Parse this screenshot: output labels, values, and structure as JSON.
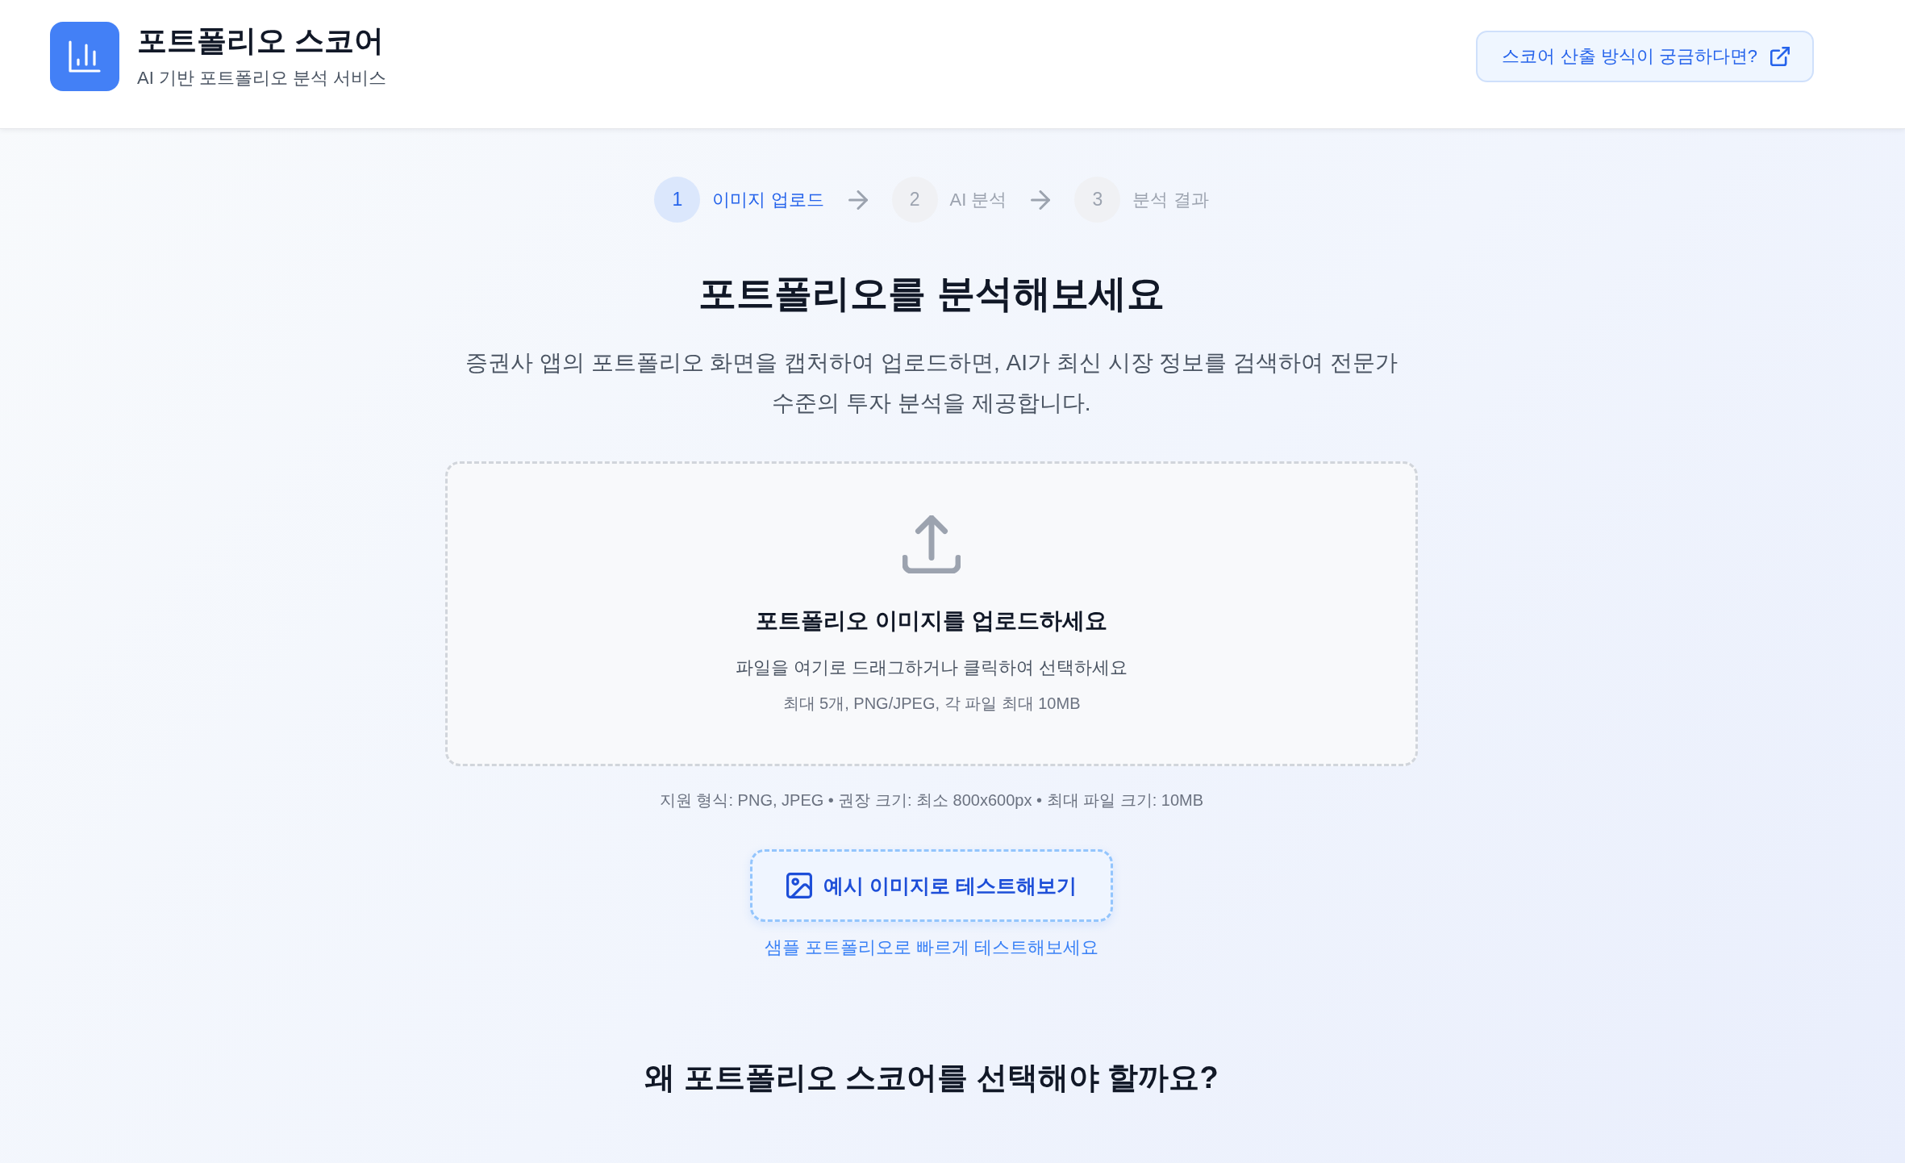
{
  "header": {
    "title": "포트폴리오 스코어",
    "subtitle": "AI 기반 포트폴리오 분석 서비스",
    "help_link": "스코어 산출 방식이 궁금하다면?"
  },
  "steps": [
    {
      "number": "1",
      "label": "이미지 업로드",
      "active": true
    },
    {
      "number": "2",
      "label": "AI 분석",
      "active": false
    },
    {
      "number": "3",
      "label": "분석 결과",
      "active": false
    }
  ],
  "hero": {
    "title": "포트폴리오를 분석해보세요",
    "description": "증권사 앱의 포트폴리오 화면을 캡처하여 업로드하면, AI가 최신 시장 정보를 검색하여 전문가 수준의 투자 분석을 제공합니다."
  },
  "upload": {
    "title": "포트폴리오 이미지를 업로드하세요",
    "hint": "파일을 여기로 드래그하거나 클릭하여 선택하세요",
    "limits": "최대 5개, PNG/JPEG, 각 파일 최대 10MB"
  },
  "formats_note": "지원 형식: PNG, JPEG • 권장 크기: 최소 800x600px • 최대 파일 크기: 10MB",
  "sample": {
    "button": "예시 이미지로 테스트해보기",
    "caption": "샘플 포트폴리오로 빠르게 테스트해보세요"
  },
  "features": {
    "title": "왜 포트폴리오 스코어를 선택해야 할까요?"
  }
}
